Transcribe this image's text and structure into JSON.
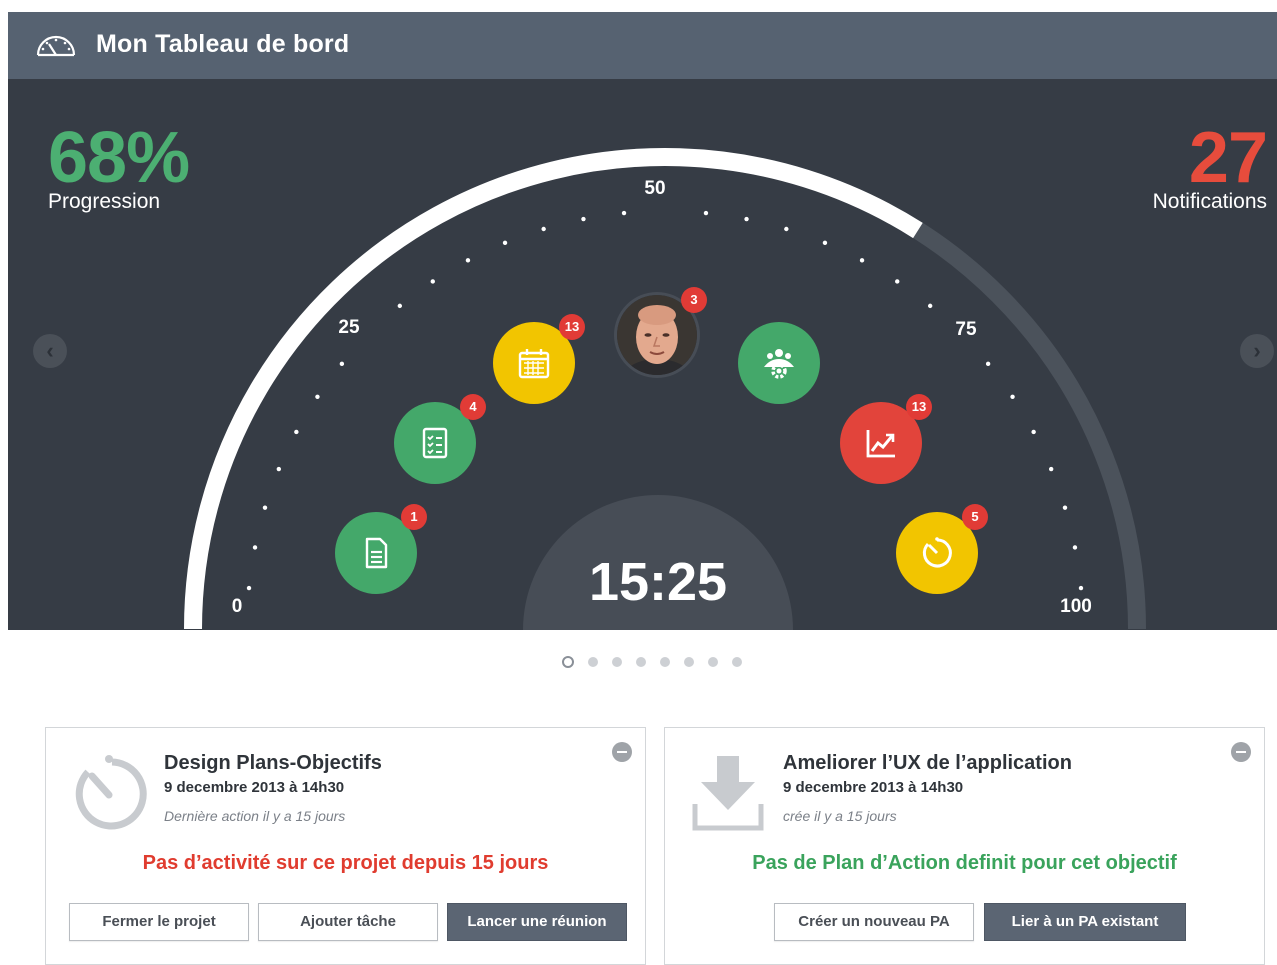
{
  "header": {
    "title": "Mon Tableau de bord",
    "icon": "speedometer-icon"
  },
  "stats": {
    "progress": {
      "value": "68%",
      "label": "Progression",
      "color": "#4caf72"
    },
    "notifications": {
      "value": "27",
      "label": "Notifications",
      "color": "#e74c3c"
    }
  },
  "gauge": {
    "tick_labels": [
      "0",
      "25",
      "50",
      "75",
      "100"
    ],
    "progress_fraction": 0.68,
    "time": "15:25"
  },
  "nodes": [
    {
      "name": "document-icon",
      "badge": "1",
      "color": "#44a86a"
    },
    {
      "name": "checklist-icon",
      "badge": "4",
      "color": "#44a86a"
    },
    {
      "name": "calendar-icon",
      "badge": "13",
      "color": "#f2c500"
    },
    {
      "name": "user-avatar",
      "badge": "3",
      "color": "#2c3138"
    },
    {
      "name": "team-settings-icon",
      "badge": "",
      "color": "#44a86a"
    },
    {
      "name": "chart-trend-icon",
      "badge": "13",
      "color": "#e2443b"
    },
    {
      "name": "timer-icon",
      "badge": "5",
      "color": "#f2c500"
    }
  ],
  "pager": {
    "total": 8,
    "active_index": 0
  },
  "cards": [
    {
      "icon": "timer-icon",
      "title": "Design Plans-Objectifs",
      "date": "9 decembre 2013 à 14h30",
      "meta": "Dernière action il y a 15 jours",
      "message": "Pas d’activité sur ce projet depuis 15 jours",
      "message_color": "#e03c2f",
      "buttons": [
        "Fermer le projet",
        "Ajouter tâche",
        "Lancer une réunion"
      ]
    },
    {
      "icon": "download-icon",
      "title": "Ameliorer l’UX de l’application",
      "date": "9 decembre 2013 à 14h30",
      "meta": "crée il y a 15 jours",
      "message": "Pas de Plan d’Action definit pour cet objectif",
      "message_color": "#3aa35c",
      "buttons": [
        "Créer un nouveau PA",
        "Lier à un PA existant"
      ]
    }
  ]
}
